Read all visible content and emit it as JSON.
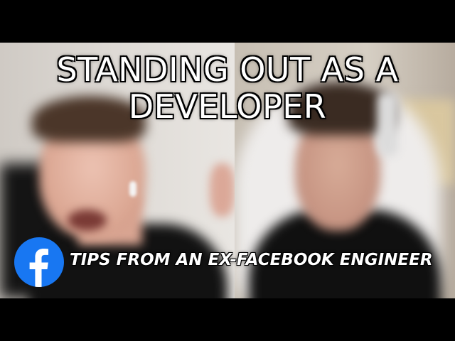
{
  "title": {
    "line1": "STANDING OUT AS A",
    "line2": "DEVELOPER"
  },
  "subtitle": "TIPS FROM AN EX-FACEBOOK ENGINEER",
  "logo": {
    "icon": "facebook-logo-icon",
    "color": "#1877f2"
  }
}
